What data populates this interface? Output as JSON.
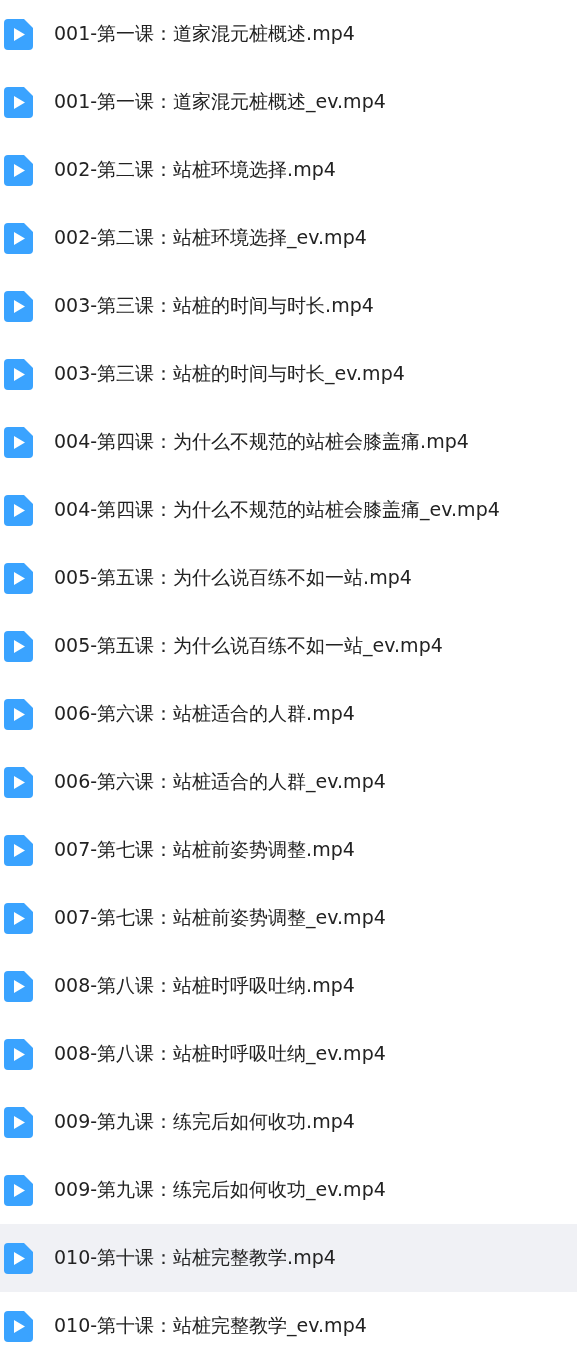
{
  "files": [
    {
      "name": "001-第一课：道家混元桩概述.mp4",
      "selected": false
    },
    {
      "name": "001-第一课：道家混元桩概述_ev.mp4",
      "selected": false
    },
    {
      "name": "002-第二课：站桩环境选择.mp4",
      "selected": false
    },
    {
      "name": "002-第二课：站桩环境选择_ev.mp4",
      "selected": false
    },
    {
      "name": "003-第三课：站桩的时间与时长.mp4",
      "selected": false
    },
    {
      "name": "003-第三课：站桩的时间与时长_ev.mp4",
      "selected": false
    },
    {
      "name": "004-第四课：为什么不规范的站桩会膝盖痛.mp4",
      "selected": false
    },
    {
      "name": "004-第四课：为什么不规范的站桩会膝盖痛_ev.mp4",
      "selected": false
    },
    {
      "name": "005-第五课：为什么说百练不如一站.mp4",
      "selected": false
    },
    {
      "name": "005-第五课：为什么说百练不如一站_ev.mp4",
      "selected": false
    },
    {
      "name": "006-第六课：站桩适合的人群.mp4",
      "selected": false
    },
    {
      "name": "006-第六课：站桩适合的人群_ev.mp4",
      "selected": false
    },
    {
      "name": "007-第七课：站桩前姿势调整.mp4",
      "selected": false
    },
    {
      "name": "007-第七课：站桩前姿势调整_ev.mp4",
      "selected": false
    },
    {
      "name": "008-第八课：站桩时呼吸吐纳.mp4",
      "selected": false
    },
    {
      "name": "008-第八课：站桩时呼吸吐纳_ev.mp4",
      "selected": false
    },
    {
      "name": "009-第九课：练完后如何收功.mp4",
      "selected": false
    },
    {
      "name": "009-第九课：练完后如何收功_ev.mp4",
      "selected": false
    },
    {
      "name": "010-第十课：站桩完整教学.mp4",
      "selected": true
    },
    {
      "name": "010-第十课：站桩完整教学_ev.mp4",
      "selected": false
    }
  ]
}
